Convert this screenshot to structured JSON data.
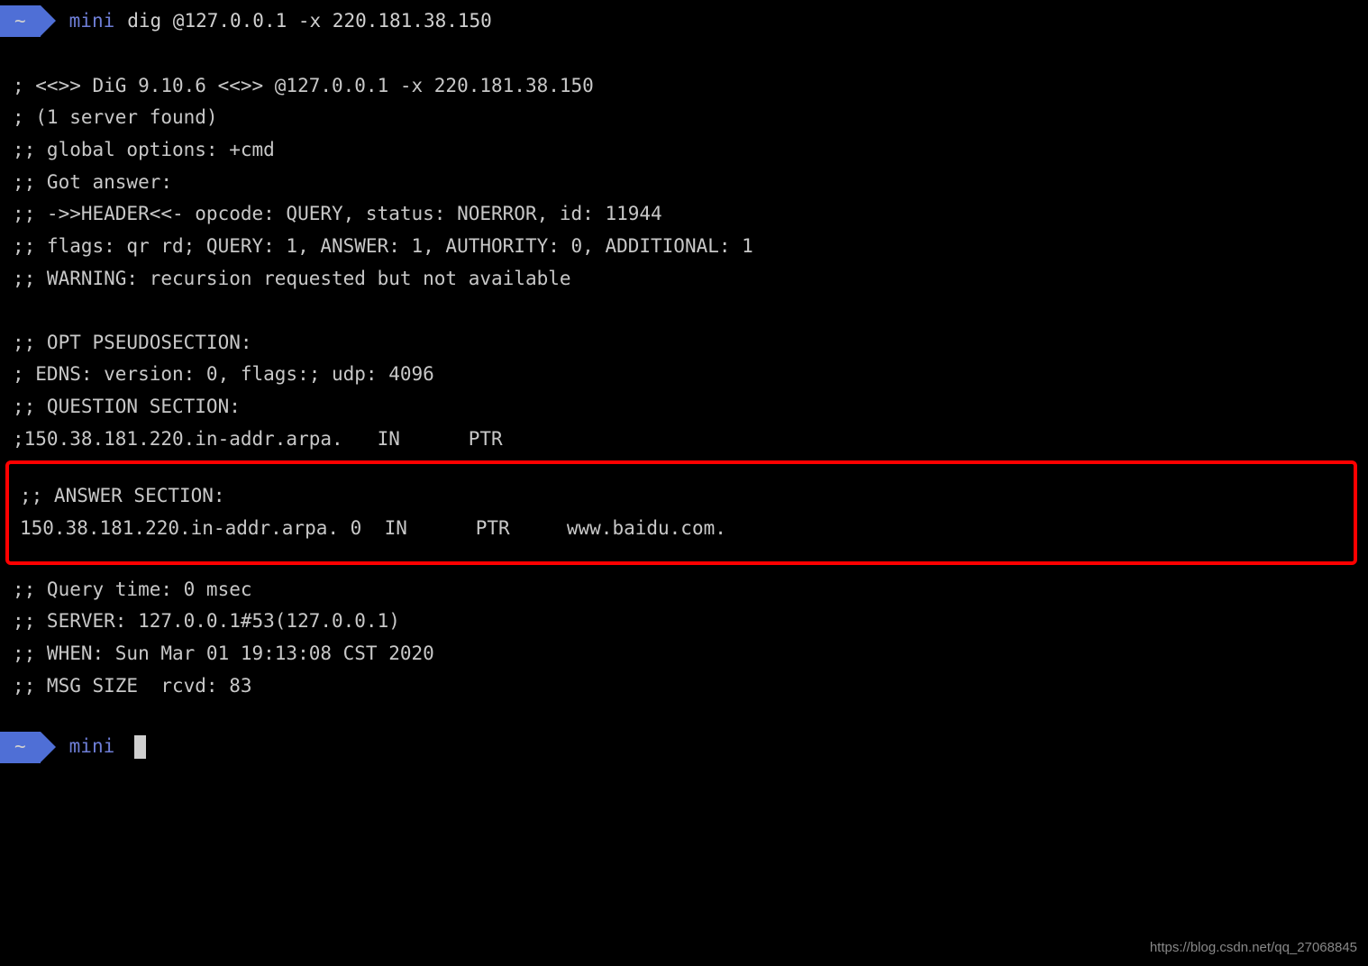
{
  "prompt1": {
    "badge": "~",
    "host": "mini",
    "command": "dig @127.0.0.1 -x 220.181.38.150"
  },
  "output": {
    "l1": "; <<>> DiG 9.10.6 <<>> @127.0.0.1 -x 220.181.38.150",
    "l2": "; (1 server found)",
    "l3": ";; global options: +cmd",
    "l4": ";; Got answer:",
    "l5": ";; ->>HEADER<<- opcode: QUERY, status: NOERROR, id: 11944",
    "l6": ";; flags: qr rd; QUERY: 1, ANSWER: 1, AUTHORITY: 0, ADDITIONAL: 1",
    "l7": ";; WARNING: recursion requested but not available",
    "l8": ";; OPT PSEUDOSECTION:",
    "l9": "; EDNS: version: 0, flags:; udp: 4096",
    "l10": ";; QUESTION SECTION:",
    "l11": ";150.38.181.220.in-addr.arpa.   IN      PTR",
    "h1": ";; ANSWER SECTION:",
    "h2": "150.38.181.220.in-addr.arpa. 0  IN      PTR     www.baidu.com.",
    "l12": ";; Query time: 0 msec",
    "l13": ";; SERVER: 127.0.0.1#53(127.0.0.1)",
    "l14": ";; WHEN: Sun Mar 01 19:13:08 CST 2020",
    "l15": ";; MSG SIZE  rcvd: 83"
  },
  "prompt2": {
    "badge": "~",
    "host": "mini"
  },
  "watermark": "https://blog.csdn.net/qq_27068845"
}
